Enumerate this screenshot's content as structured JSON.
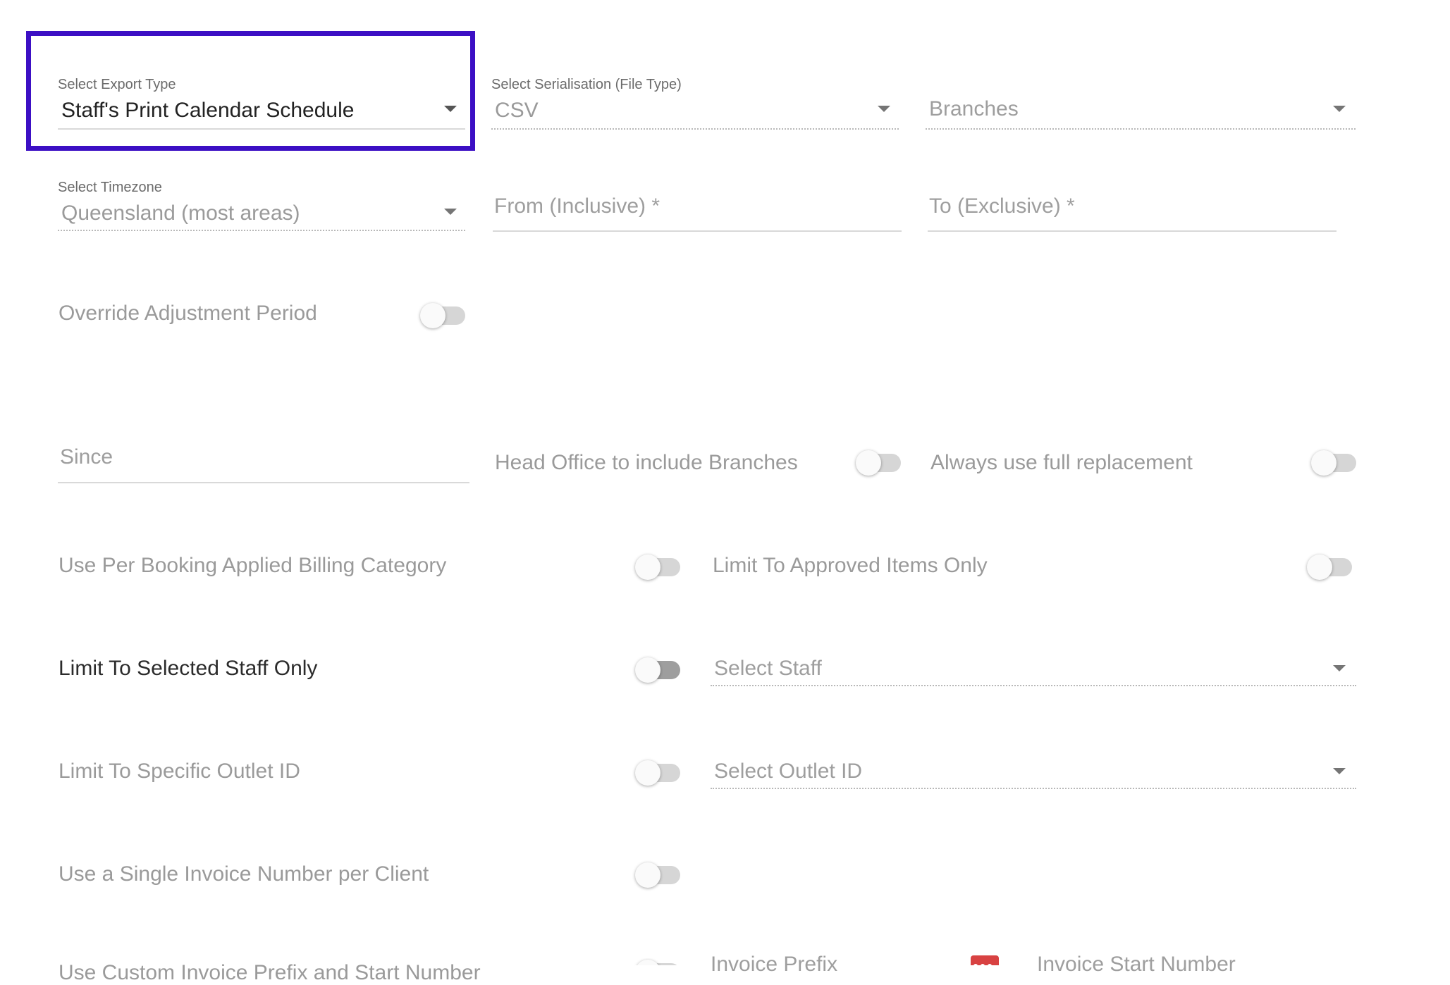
{
  "export_type": {
    "label": "Select Export Type",
    "value": "Staff's Print Calendar Schedule"
  },
  "serialisation": {
    "label": "Select Serialisation (File Type)",
    "value": "CSV"
  },
  "branches": {
    "placeholder": "Branches"
  },
  "timezone": {
    "label": "Select Timezone",
    "value": "Queensland (most areas)"
  },
  "from_field": {
    "placeholder": "From (Inclusive) *"
  },
  "to_field": {
    "placeholder": "To (Exclusive) *"
  },
  "override_adjustment": {
    "label": "Override Adjustment Period",
    "checked": false
  },
  "since_field": {
    "placeholder": "Since"
  },
  "head_office": {
    "label": "Head Office to include Branches",
    "checked": false
  },
  "full_replacement": {
    "label": "Always use full replacement",
    "checked": false
  },
  "per_booking_billing": {
    "label": "Use Per Booking Applied Billing Category",
    "checked": false
  },
  "approved_only": {
    "label": "Limit To Approved Items Only",
    "checked": false
  },
  "selected_staff_only": {
    "label": "Limit To Selected Staff Only",
    "checked": false
  },
  "select_staff": {
    "placeholder": "Select Staff"
  },
  "specific_outlet": {
    "label": "Limit To Specific Outlet ID",
    "checked": false
  },
  "select_outlet": {
    "placeholder": "Select Outlet ID"
  },
  "single_invoice": {
    "label": "Use a Single Invoice Number per Client",
    "checked": false
  },
  "custom_invoice": {
    "label": "Use Custom Invoice Prefix and Start Number",
    "checked": false
  },
  "invoice_prefix": {
    "placeholder": "Invoice Prefix"
  },
  "invoice_start": {
    "placeholder": "Invoice Start Number"
  },
  "colors": {
    "highlight": "#3c0fc4",
    "calendar_icon": "#d84242"
  }
}
